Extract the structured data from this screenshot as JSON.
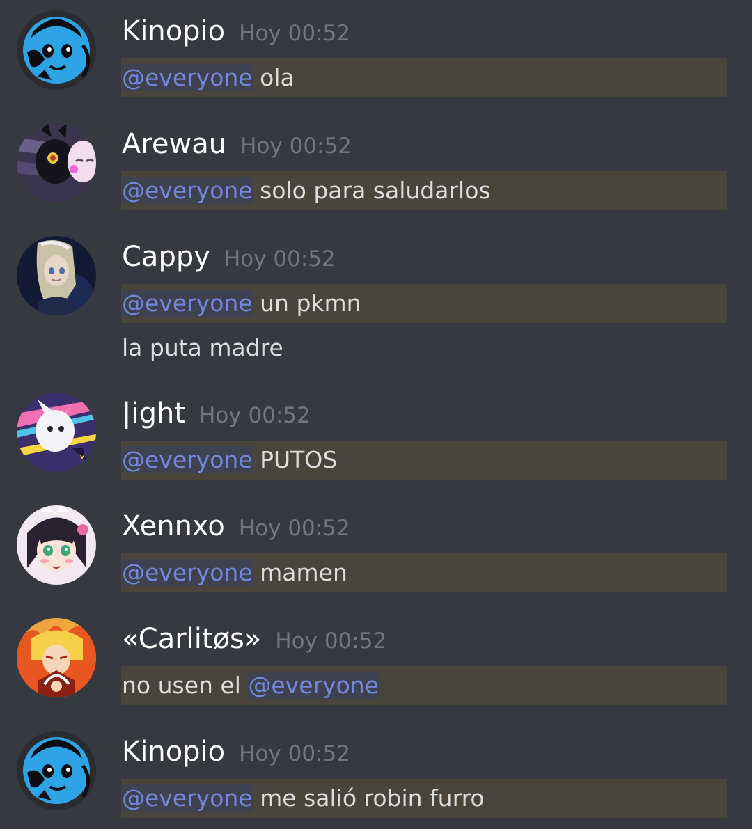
{
  "colors": {
    "background": "#36393f",
    "username": "#ffffff",
    "timestamp": "#72767d",
    "text": "#dcddde",
    "mention_text": "#7289da",
    "mention_bg": "#3e4150",
    "highlight_bg": "#49443c"
  },
  "messages": [
    {
      "author": "Kinopio",
      "timestamp": "Hoy 00:52",
      "avatar_icon": "blue-sketch-avatar-icon",
      "lines": [
        {
          "mention": "@everyone",
          "text": " ola"
        }
      ]
    },
    {
      "author": "Arewau",
      "timestamp": "Hoy 00:52",
      "avatar_icon": "umbreon-espeon-avatar-icon",
      "lines": [
        {
          "mention": "@everyone",
          "text": " solo para saludarlos"
        }
      ]
    },
    {
      "author": "Cappy",
      "timestamp": "Hoy 00:52",
      "avatar_icon": "anime-girl-dark-avatar-icon",
      "lines": [
        {
          "mention": "@everyone",
          "text": " un pkmn"
        },
        {
          "text": "la puta madre"
        }
      ]
    },
    {
      "author": "|ight",
      "timestamp": "Hoy 00:52",
      "avatar_icon": "white-creature-avatar-icon",
      "lines": [
        {
          "mention": "@everyone",
          "text": " PUTOS"
        }
      ]
    },
    {
      "author": "Xennxo",
      "timestamp": "Hoy 00:52",
      "avatar_icon": "anime-girl-maid-avatar-icon",
      "lines": [
        {
          "mention": "@everyone",
          "text": " mamen"
        }
      ]
    },
    {
      "author": "«Carlitøs»",
      "timestamp": "Hoy 00:52",
      "avatar_icon": "flame-hero-avatar-icon",
      "lines": [
        {
          "text": "no usen el ",
          "mention_after": "@everyone"
        }
      ]
    },
    {
      "author": "Kinopio",
      "timestamp": "Hoy 00:52",
      "avatar_icon": "blue-sketch-avatar-icon",
      "lines": [
        {
          "mention": "@everyone",
          "text": " me salió robin furro"
        }
      ]
    }
  ]
}
